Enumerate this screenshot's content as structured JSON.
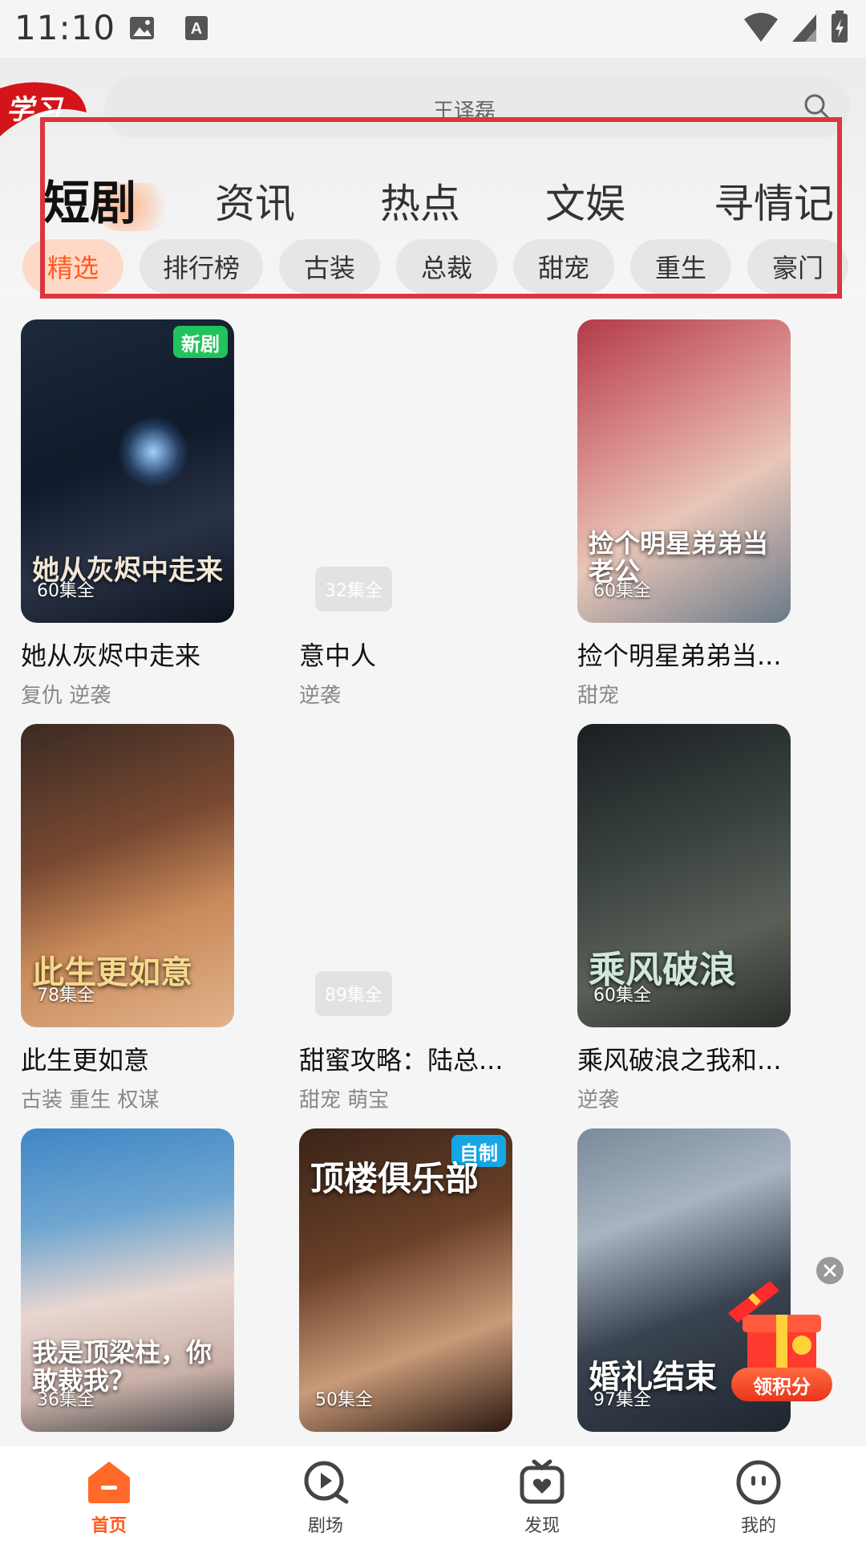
{
  "status_bar": {
    "time": "11:10"
  },
  "search": {
    "placeholder": "王译磊"
  },
  "channel_tabs": [
    {
      "label": "短剧",
      "active": true
    },
    {
      "label": "资讯"
    },
    {
      "label": "热点"
    },
    {
      "label": "文娱"
    },
    {
      "label": "寻情记"
    }
  ],
  "chips": [
    {
      "label": "精选",
      "active": true
    },
    {
      "label": "排行榜"
    },
    {
      "label": "古装"
    },
    {
      "label": "总裁"
    },
    {
      "label": "甜宠"
    },
    {
      "label": "重生"
    },
    {
      "label": "豪门"
    }
  ],
  "dramas": [
    {
      "title": "她从灰烬中走来",
      "tags": "复仇 逆袭",
      "episodes": "60集全",
      "badge": "新剧",
      "poster_text": "她从灰烬中走来"
    },
    {
      "title": "意中人",
      "tags": "逆袭",
      "episodes": "32集全"
    },
    {
      "title": "捡个明星弟弟当...",
      "tags": "甜宠",
      "episodes": "60集全",
      "poster_text": "捡个明星弟弟当老公"
    },
    {
      "title": "此生更如意",
      "tags": "古装 重生 权谋",
      "episodes": "78集全",
      "poster_text": "此生更如意"
    },
    {
      "title": "甜蜜攻略：陆总...",
      "tags": "甜宠 萌宝",
      "episodes": "89集全"
    },
    {
      "title": "乘风破浪之我和...",
      "tags": "逆袭",
      "episodes": "60集全",
      "poster_text": "乘风破浪"
    },
    {
      "episodes": "36集全",
      "poster_text": "我是顶梁柱，你敢裁我？"
    },
    {
      "episodes": "50集全",
      "badge": "自制",
      "poster_text": "顶楼俱乐部"
    },
    {
      "episodes": "97集全",
      "poster_text": "婚礼结束"
    }
  ],
  "floating": {
    "gift_label": "领积分"
  },
  "bottom_nav": [
    {
      "label": "首页",
      "active": true
    },
    {
      "label": "剧场"
    },
    {
      "label": "发现"
    },
    {
      "label": "我的"
    }
  ]
}
